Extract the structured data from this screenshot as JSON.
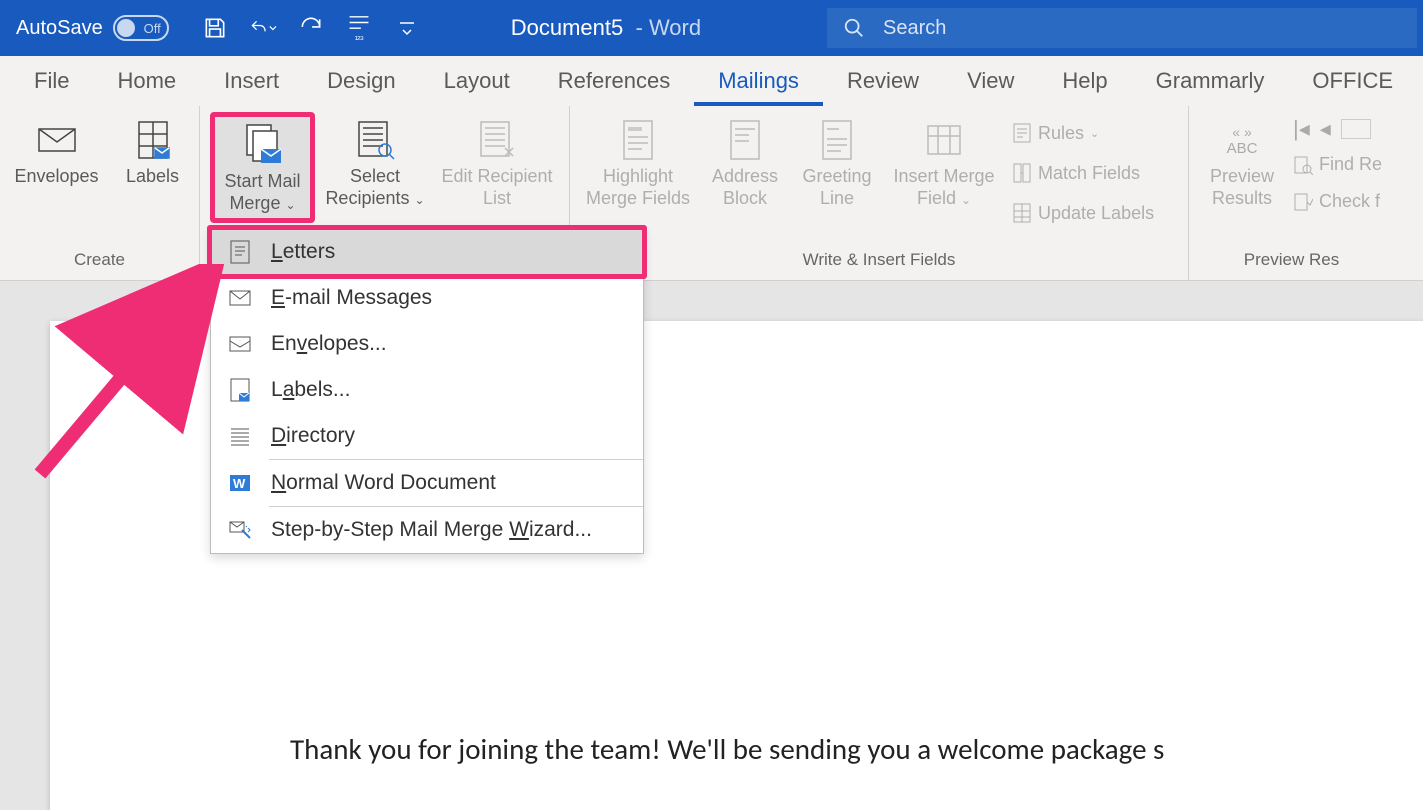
{
  "titlebar": {
    "autosave_label": "AutoSave",
    "autosave_state": "Off",
    "document_name": "Document5",
    "app_name": "Word",
    "search_placeholder": "Search"
  },
  "tabs": [
    "File",
    "Home",
    "Insert",
    "Design",
    "Layout",
    "References",
    "Mailings",
    "Review",
    "View",
    "Help",
    "Grammarly",
    "OFFICE"
  ],
  "active_tab": "Mailings",
  "ribbon": {
    "create": {
      "label": "Create",
      "envelopes": "Envelopes",
      "labels": "Labels"
    },
    "start": {
      "start_mail_merge": "Start Mail Merge",
      "select_recipients": "Select Recipients",
      "edit_recipient_list": "Edit Recipient List"
    },
    "write": {
      "label": "Write & Insert Fields",
      "highlight": "Highlight Merge Fields",
      "address_block": "Address Block",
      "greeting_line": "Greeting Line",
      "insert_merge_field": "Insert Merge Field",
      "rules": "Rules",
      "match_fields": "Match Fields",
      "update_labels": "Update Labels"
    },
    "preview": {
      "label": "Preview Res",
      "preview_results": "Preview Results",
      "abc": "ABC",
      "find_recipient": "Find Re",
      "check_errors": "Check f"
    }
  },
  "dropdown": {
    "letters": "Letters",
    "email": "E-mail Messages",
    "envelopes": "Envelopes...",
    "labels": "Labels...",
    "directory": "Directory",
    "normal": "Normal Word Document",
    "wizard": "Step-by-Step Mail Merge Wizard..."
  },
  "document": {
    "body": "Thank you for joining the team! We'll be sending you a welcome package s"
  }
}
